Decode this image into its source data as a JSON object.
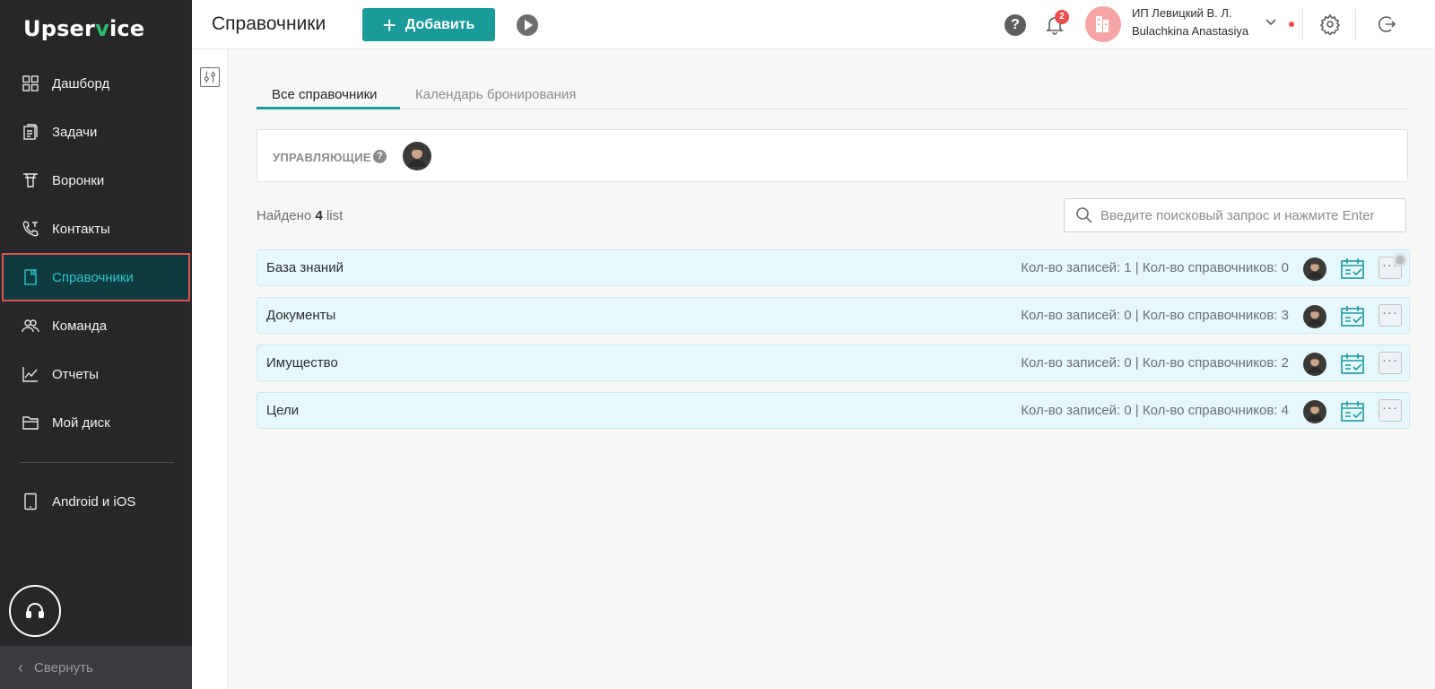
{
  "sidebar": {
    "logo_prefix": "Upser",
    "logo_v": "v",
    "logo_suffix": "ice",
    "items": [
      {
        "label": "Дашборд",
        "icon": "dashboard-grid-icon"
      },
      {
        "label": "Задачи",
        "icon": "tasks-clipboard-icon"
      },
      {
        "label": "Воронки",
        "icon": "funnel-icon"
      },
      {
        "label": "Контакты",
        "icon": "phone-contact-icon"
      },
      {
        "label": "Справочники",
        "icon": "book-icon",
        "active": true
      },
      {
        "label": "Команда",
        "icon": "team-icon"
      },
      {
        "label": "Отчеты",
        "icon": "chart-line-icon"
      },
      {
        "label": "Мой диск",
        "icon": "folder-icon"
      }
    ],
    "mobile_label": "Android и iOS",
    "collapse_label": "Свернуть"
  },
  "header": {
    "title": "Справочники",
    "add_label": "Добавить",
    "notifications_count": "2",
    "company_name": "ИП Левицкий В. Л.",
    "user_name": "Bulachkina Anastasiya",
    "help_symbol": "?"
  },
  "tabs": [
    {
      "label": "Все справочники",
      "active": true
    },
    {
      "label": "Календарь бронирования",
      "active": false
    }
  ],
  "managers": {
    "label": "УПРАВЛЯЮЩИЕ",
    "help_symbol": "?"
  },
  "found": {
    "prefix": "Найдено",
    "count": "4",
    "suffix": "list"
  },
  "search": {
    "placeholder": "Введите поисковый запрос и нажмите Enter",
    "value": ""
  },
  "lists": [
    {
      "name": "База знаний",
      "stats": "Кол-во записей: 1 | Кол-во справочников: 0"
    },
    {
      "name": "Документы",
      "stats": "Кол-во записей: 0 | Кол-во справочников: 3"
    },
    {
      "name": "Имущество",
      "stats": "Кол-во записей: 0 | Кол-во справочников: 2"
    },
    {
      "name": "Цели",
      "stats": "Кол-во записей: 0 | Кол-во справочников: 4"
    }
  ],
  "row_menu_symbol": "···",
  "colors": {
    "sidebar_bg": "#262729",
    "accent": "#1b9a9a",
    "active_text": "#2fc4c6",
    "row_bg": "#e6f8fb",
    "badge": "#ea4d4d"
  }
}
